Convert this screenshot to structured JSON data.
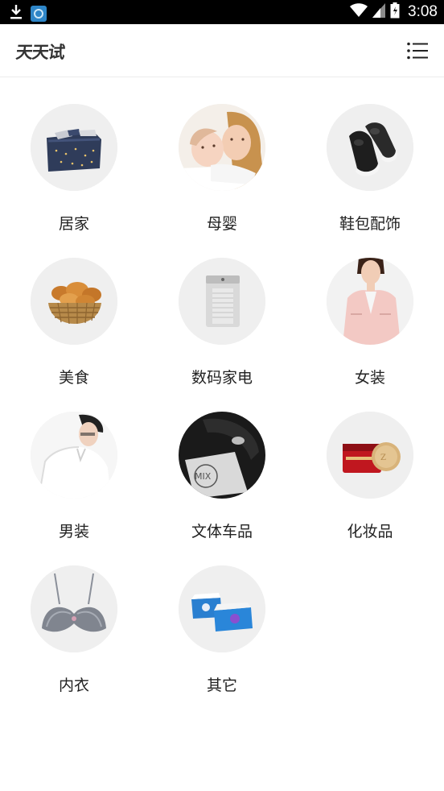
{
  "status_bar": {
    "time": "3:08",
    "icons": [
      "download-icon",
      "app-notification-icon",
      "wifi-icon",
      "signal-icon",
      "battery-icon"
    ]
  },
  "header": {
    "logo": "天天试",
    "menu_icon": "list-menu-icon"
  },
  "categories": [
    {
      "label": "居家",
      "icon": "bedding-image"
    },
    {
      "label": "母婴",
      "icon": "mother-baby-image"
    },
    {
      "label": "鞋包配饰",
      "icon": "sneakers-image"
    },
    {
      "label": "美食",
      "icon": "bread-basket-image"
    },
    {
      "label": "数码家电",
      "icon": "air-purifier-image"
    },
    {
      "label": "女装",
      "icon": "womens-jacket-image"
    },
    {
      "label": "男装",
      "icon": "mens-shirt-image"
    },
    {
      "label": "文体车品",
      "icon": "car-interior-image"
    },
    {
      "label": "化妆品",
      "icon": "cream-jar-image"
    },
    {
      "label": "内衣",
      "icon": "bra-image"
    },
    {
      "label": "其它",
      "icon": "tissue-box-image"
    }
  ],
  "colors": {
    "status_bar": "#000000",
    "circle_bg": "#efefef",
    "label_text": "#222222",
    "logo_text": "#333333"
  }
}
